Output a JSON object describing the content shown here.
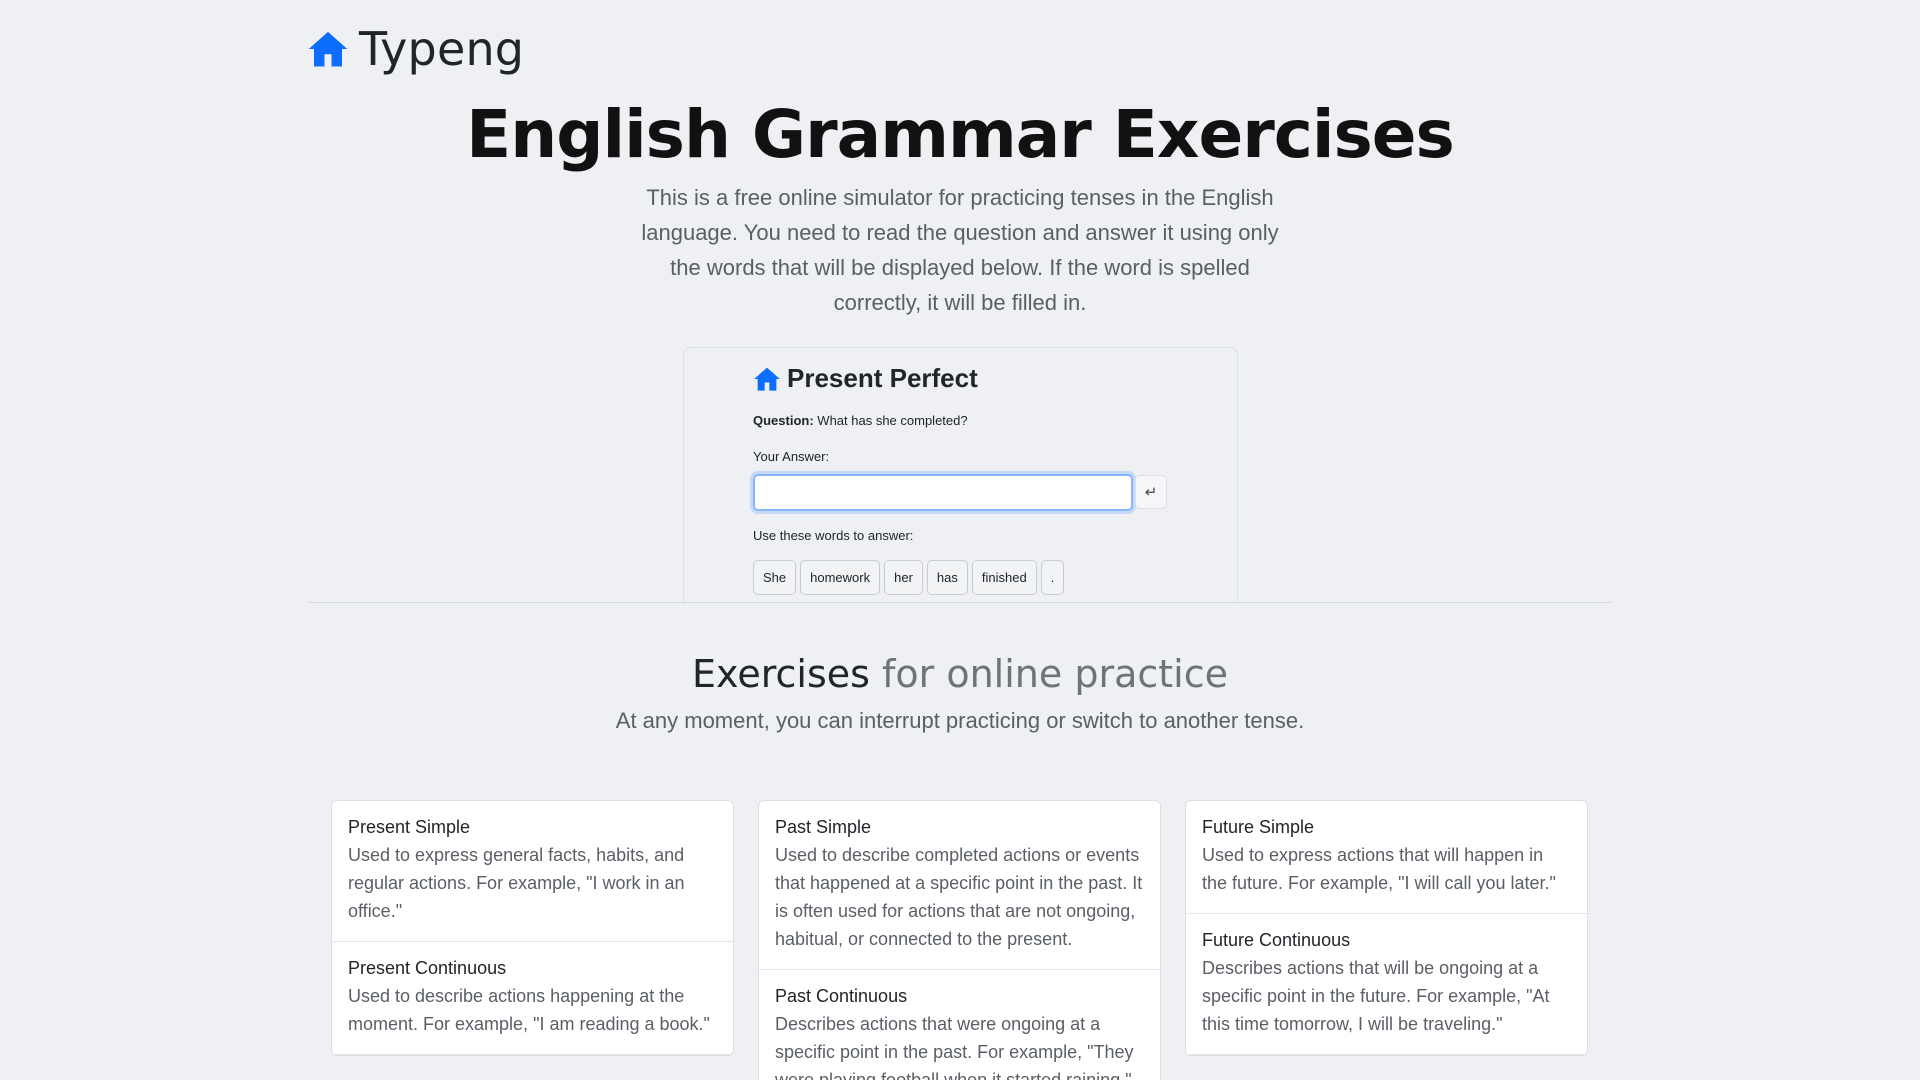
{
  "brand": {
    "name": "Typeng",
    "icon": "home-icon",
    "color": "#0d6efd"
  },
  "hero": {
    "title": "English Grammar Exercises",
    "lead": "This is a free online simulator for practicing tenses in the English language. You need to read the question and answer it using only the words that will be displayed below. If the word is spelled correctly, it will be filled in."
  },
  "demo": {
    "title": "Present Perfect",
    "question_label": "Question:",
    "question_text": "What has she completed?",
    "answer_label": "Your Answer:",
    "answer_value": "",
    "enter_symbol": "↵",
    "words_label": "Use these words to answer:",
    "words": [
      "She",
      "homework",
      "her",
      "has",
      "finished",
      "."
    ]
  },
  "section": {
    "title_strong": "Exercises",
    "title_muted": "for online practice",
    "lead": "At any moment, you can interrupt practicing or switch to another tense."
  },
  "columns": [
    [
      {
        "title": "Present Simple",
        "desc": "Used to express general facts, habits, and regular actions. For example, \"I work in an office.\""
      },
      {
        "title": "Present Continuous",
        "desc": "Used to describe actions happening at the moment. For example, \"I am reading a book.\""
      }
    ],
    [
      {
        "title": "Past Simple",
        "desc": "Used to describe completed actions or events that happened at a specific point in the past. It is often used for actions that are not ongoing, habitual, or connected to the present."
      },
      {
        "title": "Past Continuous",
        "desc": "Describes actions that were ongoing at a specific point in the past. For example, \"They were playing football when it started raining.\""
      }
    ],
    [
      {
        "title": "Future Simple",
        "desc": "Used to express actions that will happen in the future. For example, \"I will call you later.\""
      },
      {
        "title": "Future Continuous",
        "desc": "Describes actions that will be ongoing at a specific point in the future. For example, \"At this time tomorrow, I will be traveling.\""
      }
    ]
  ]
}
